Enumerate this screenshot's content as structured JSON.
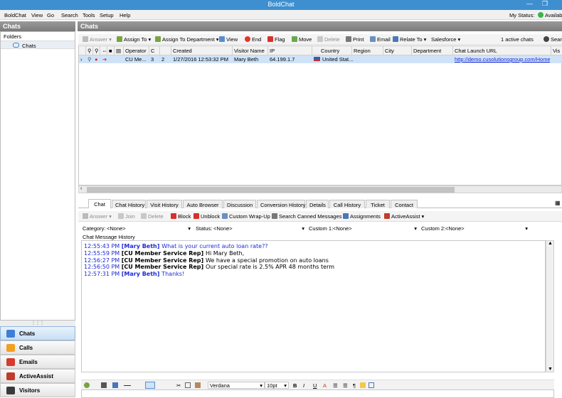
{
  "window": {
    "title": "BoldChat"
  },
  "menu": [
    "BoldChat",
    "View",
    "Go",
    "Search",
    "Tools",
    "Setup",
    "Help"
  ],
  "my_status": {
    "label": "My Status:",
    "value": "Availabl"
  },
  "left": {
    "header": "Chats",
    "folders_label": "Folders",
    "tree_item": "Chats",
    "nav": [
      {
        "label": "Chats",
        "color": "#3d7fd6"
      },
      {
        "label": "Calls",
        "color": "#f2a020"
      },
      {
        "label": "Emails",
        "color": "#d63b2c"
      },
      {
        "label": "ActiveAssist",
        "color": "#c03c2a"
      },
      {
        "label": "Visitors",
        "color": "#3a3a3a"
      }
    ]
  },
  "main": {
    "header": "Chats",
    "toolbar": [
      "Answer",
      "Assign To",
      "Assign To Department",
      "View",
      "End",
      "Flag",
      "Move",
      "Delete",
      "Print",
      "Email",
      "Relate To",
      "Salesforce",
      "1 active chats",
      "Search"
    ],
    "columns": [
      "Operator",
      "C",
      "",
      "Created",
      "Visitor Name",
      "IP",
      "Country",
      "Region",
      "City",
      "Department",
      "Chat Launch URL",
      "Vis"
    ],
    "row": {
      "operator": "CU Me...",
      "c1": "3",
      "c2": "2",
      "created": "1/27/2016 12:53:32 PM",
      "visitor": "Mary Beth",
      "ip": "64.199.1.7",
      "country": "United Stat...",
      "region": "",
      "city": "",
      "department": "",
      "url": "http://demo.cusolutionsgroup.com/Home_..."
    }
  },
  "tabs": [
    "Chat",
    "Chat History",
    "Visit History",
    "Auto Browser",
    "Discussion",
    "Conversion History",
    "Details",
    "Call History",
    "Ticket",
    "Contact"
  ],
  "chat_toolbar": [
    "Answer",
    "Join",
    "Delete",
    "Block",
    "Unblock",
    "Custom Wrap-Up",
    "Search Canned Messages",
    "Assignments",
    "ActiveAssist"
  ],
  "fields": {
    "category_label": "Category:",
    "category_value": "<None>",
    "status_label": "Status:",
    "status_value": "<None>",
    "custom1_label": "Custom 1:",
    "custom1_value": "<None>",
    "custom2_label": "Custom 2:",
    "custom2_value": "<None>"
  },
  "history_label": "Chat Message History",
  "messages": [
    {
      "time": "12:55:43 PM",
      "who": "[Mary Beth]",
      "text": "What is your current auto loan rate??",
      "visitor": true
    },
    {
      "time": "12:55:59 PM",
      "who": "[CU Member Service Rep]",
      "text": "Hi Mary Beth,",
      "visitor": false
    },
    {
      "time": "12:56:27 PM",
      "who": "[CU Member Service Rep]",
      "text": "We have a special promotion on auto loans",
      "visitor": false
    },
    {
      "time": "12:56:50 PM",
      "who": "[CU Member Service Rep]",
      "text": "Our special rate is 2.5% APR 48 months term",
      "visitor": false
    },
    {
      "time": "12:57:31 PM",
      "who": "[Mary Beth]",
      "text": "Thanks!",
      "visitor": true
    }
  ],
  "editor": {
    "font": "Verdana",
    "size": "10pt"
  }
}
